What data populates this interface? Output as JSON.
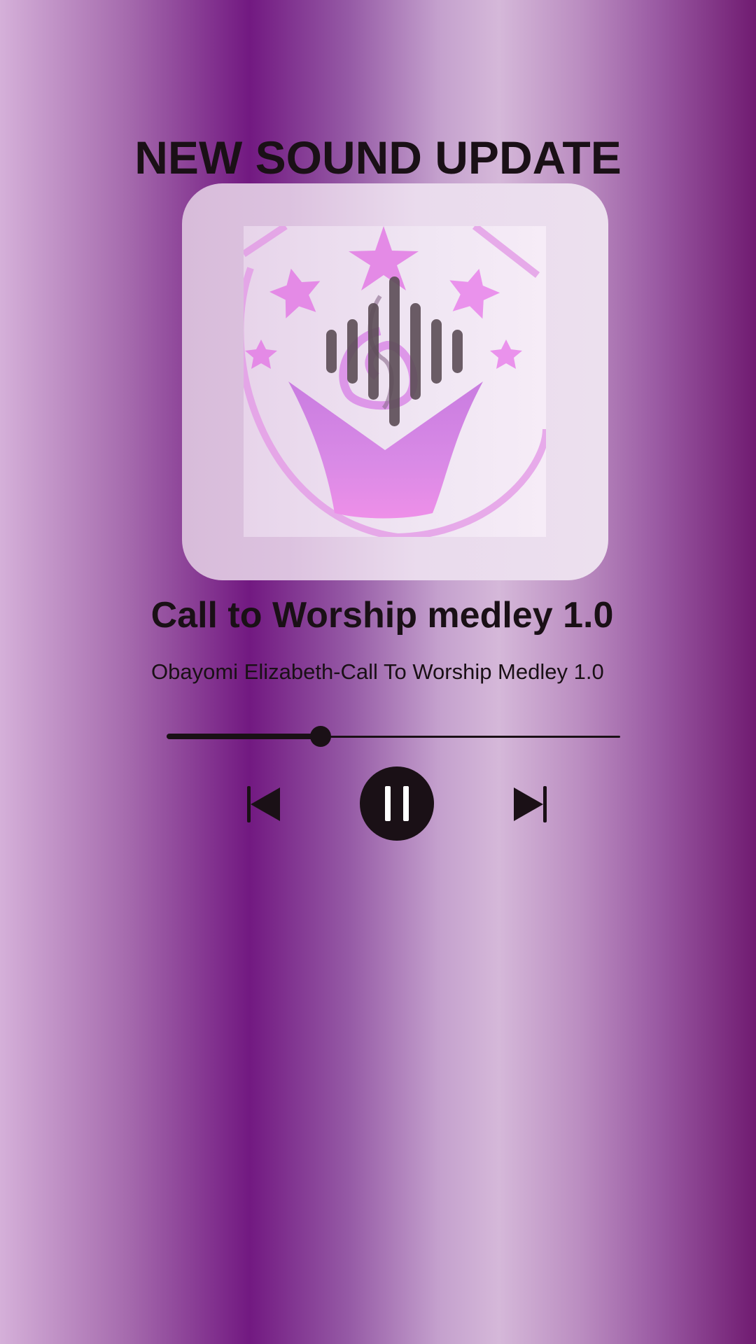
{
  "header": {
    "title": "NEW SOUND UPDATE"
  },
  "album_art": {
    "icon": "crown-stars-music-logo",
    "overlay_icon": "sound-wave-icon"
  },
  "track": {
    "title": "Call to Worship medley 1.0",
    "subtitle": "Obayomi Elizabeth-Call To Worship Medley 1.0"
  },
  "player": {
    "progress": 0.34,
    "state": "playing",
    "controls": {
      "previous": "skip-previous-icon",
      "pause": "pause-icon",
      "next": "skip-next-icon"
    }
  },
  "colors": {
    "text": "#1a1016",
    "background_purple": "#721981",
    "accent_pink": "#e686e8"
  }
}
